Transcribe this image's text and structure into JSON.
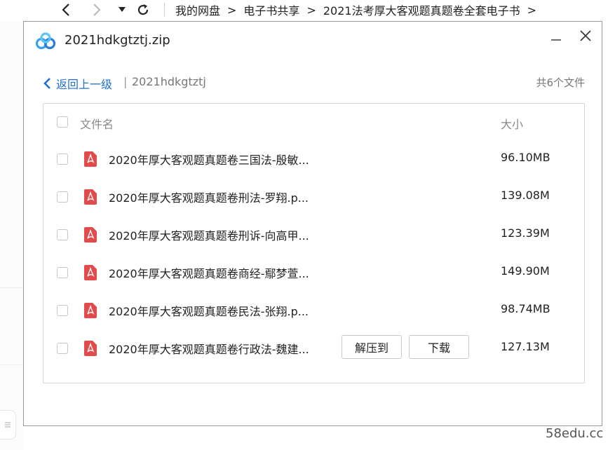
{
  "nav": {
    "back": "‹",
    "forward": "›",
    "history": "▾",
    "breadcrumbs": [
      "我的网盘",
      "电子书共享",
      "2021法考厚大客观题真题卷全套电子书"
    ],
    "separator": ">"
  },
  "dialog": {
    "title": "2021hdkgtztj.zip",
    "back_label": "返回上一级",
    "path_separator": "|",
    "current_folder": "2021hdkgtztj",
    "file_count": "共6个文件",
    "columns": {
      "name": "文件名",
      "size": "大小"
    },
    "files": [
      {
        "name": "2020年厚大客观题真题卷三国法-殷敏...",
        "size": "96.10MB"
      },
      {
        "name": "2020年厚大客观题真题卷刑法-罗翔.p...",
        "size": "139.08M"
      },
      {
        "name": "2020年厚大客观题真题卷刑诉-向高甲...",
        "size": "123.39M"
      },
      {
        "name": "2020年厚大客观题真题卷商经-鄢梦萱...",
        "size": "149.90M"
      },
      {
        "name": "2020年厚大客观题真题卷民法-张翔.p...",
        "size": "98.74MB"
      },
      {
        "name": "2020年厚大客观题真题卷行政法-魏建...",
        "size": "127.13M"
      }
    ],
    "row_actions": {
      "extract": "解压到",
      "download": "下载"
    }
  },
  "colors": {
    "accent": "#1f6fd6",
    "pdf_red": "#e24b4b",
    "border": "#9a9a9a"
  },
  "watermark": "58edu.cc"
}
